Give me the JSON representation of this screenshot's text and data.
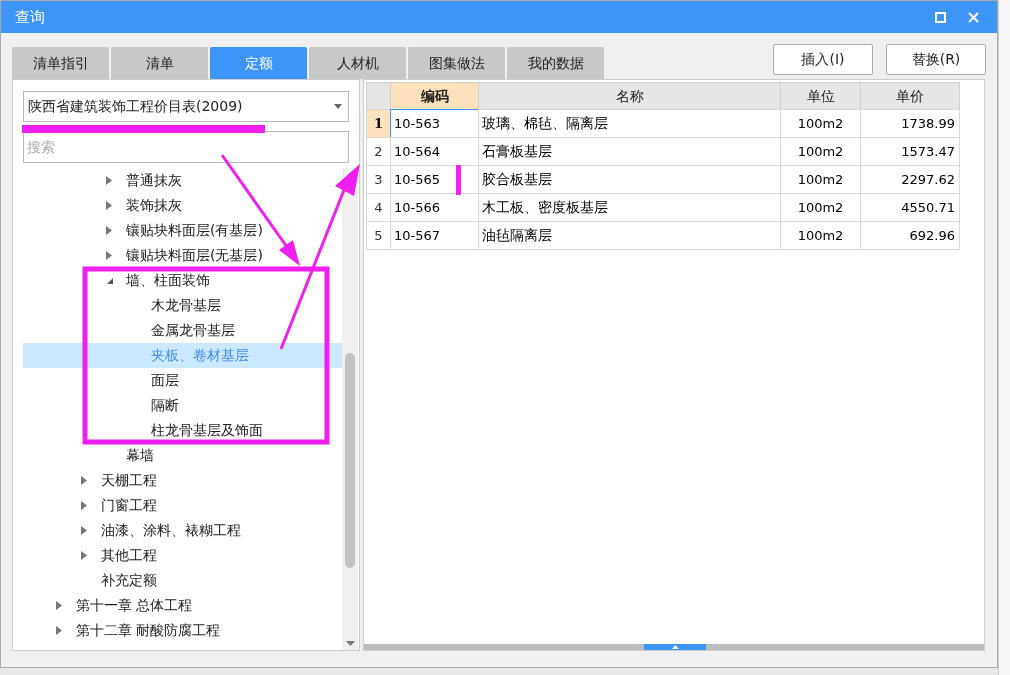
{
  "window": {
    "title": "查询"
  },
  "tabs": [
    {
      "label": "清单指引",
      "selected": false
    },
    {
      "label": "清单",
      "selected": false
    },
    {
      "label": "定额",
      "selected": true
    },
    {
      "label": "人材机",
      "selected": false
    },
    {
      "label": "图集做法",
      "selected": false
    },
    {
      "label": "我的数据",
      "selected": false
    }
  ],
  "buttons": [
    "插入(I)",
    "替换(R)"
  ],
  "library_select": {
    "value": "陕西省建筑装饰工程价目表(2009)"
  },
  "search": {
    "placeholder": "搜索"
  },
  "tree": {
    "items": [
      {
        "children": [
          {
            "children": [
              {
                "label": "普通抹灰",
                "expanded": false,
                "selected": false
              },
              {
                "label": "装饰抹灰",
                "expanded": false,
                "selected": false
              },
              {
                "label": "镶贴块料面层(有基层)",
                "expanded": false,
                "selected": false
              },
              {
                "label": "镶贴块料面层(无基层)",
                "expanded": false,
                "selected": false
              },
              {
                "label": "墙、柱面装饰",
                "expanded": true,
                "selected": false,
                "children": [
                  {
                    "label": "木龙骨基层",
                    "selected": false
                  },
                  {
                    "label": "金属龙骨基层",
                    "selected": false
                  },
                  {
                    "label": "夹板、卷材基层",
                    "selected": true
                  },
                  {
                    "label": "面层",
                    "selected": false
                  },
                  {
                    "label": "隔断",
                    "selected": false
                  },
                  {
                    "label": "柱龙骨基层及饰面",
                    "selected": false
                  }
                ]
              },
              {
                "label": "幕墙",
                "selected": false
              }
            ]
          },
          {
            "label": "天棚工程",
            "expanded": false,
            "selected": false
          },
          {
            "label": "门窗工程",
            "expanded": false,
            "selected": false
          },
          {
            "label": "油漆、涂料、裱糊工程",
            "expanded": false,
            "selected": false
          },
          {
            "label": "其他工程",
            "expanded": false,
            "selected": false
          },
          {
            "label": "补充定额",
            "selected": false
          }
        ]
      },
      {
        "label": "第十一章 总体工程",
        "expanded": false,
        "selected": false
      },
      {
        "label": "第十二章 耐酸防腐工程",
        "expanded": false,
        "selected": false
      }
    ]
  },
  "table": {
    "columns": [
      {
        "label": "编码",
        "selected": true
      },
      {
        "label": "名称",
        "selected": false
      },
      {
        "label": "单位",
        "selected": false
      },
      {
        "label": "单价",
        "selected": false
      }
    ],
    "rows": [
      {
        "num": "1",
        "code": "10-563",
        "name": "玻璃、棉毡、隔离层",
        "unit": "100m2",
        "price": "1738.99",
        "selected": true
      },
      {
        "num": "2",
        "code": "10-564",
        "name": "石膏板基层",
        "unit": "100m2",
        "price": "1573.47",
        "selected": false
      },
      {
        "num": "3",
        "code": "10-565",
        "name": "胶合板基层",
        "unit": "100m2",
        "price": "2297.62",
        "selected": false
      },
      {
        "num": "4",
        "code": "10-566",
        "name": "木工板、密度板基层",
        "unit": "100m2",
        "price": "4550.71",
        "selected": false
      },
      {
        "num": "5",
        "code": "10-567",
        "name": "油毡隔离层",
        "unit": "100m2",
        "price": "692.96",
        "selected": false
      }
    ]
  }
}
